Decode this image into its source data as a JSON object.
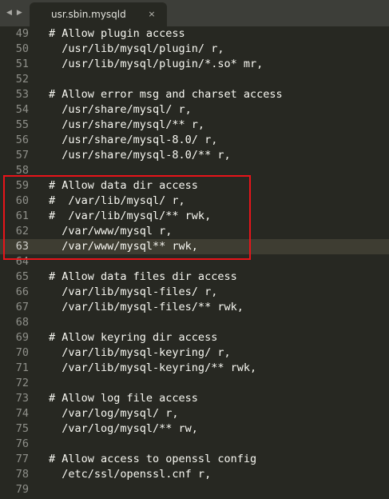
{
  "tab": {
    "title": "usr.sbin.mysqld",
    "close_glyph": "×",
    "back_glyph": "◀",
    "forward_glyph": "▶"
  },
  "colors": {
    "editor_background": "#272822",
    "tabbar_background": "#3d3e39",
    "highlight_border": "#e8141a"
  },
  "editor": {
    "current_line": 63,
    "lines": [
      {
        "num": "49",
        "text": "# Allow plugin access"
      },
      {
        "num": "50",
        "text": "  /usr/lib/mysql/plugin/ r,"
      },
      {
        "num": "51",
        "text": "  /usr/lib/mysql/plugin/*.so* mr,"
      },
      {
        "num": "52",
        "text": ""
      },
      {
        "num": "53",
        "text": "# Allow error msg and charset access"
      },
      {
        "num": "54",
        "text": "  /usr/share/mysql/ r,"
      },
      {
        "num": "55",
        "text": "  /usr/share/mysql/** r,"
      },
      {
        "num": "56",
        "text": "  /usr/share/mysql-8.0/ r,"
      },
      {
        "num": "57",
        "text": "  /usr/share/mysql-8.0/** r,"
      },
      {
        "num": "58",
        "text": ""
      },
      {
        "num": "59",
        "text": "# Allow data dir access"
      },
      {
        "num": "60",
        "text": "#  /var/lib/mysql/ r,"
      },
      {
        "num": "61",
        "text": "#  /var/lib/mysql/** rwk,"
      },
      {
        "num": "62",
        "text": "  /var/www/mysql r,"
      },
      {
        "num": "63",
        "text": "  /var/www/mysql** rwk,"
      },
      {
        "num": "64",
        "text": ""
      },
      {
        "num": "65",
        "text": "# Allow data files dir access"
      },
      {
        "num": "66",
        "text": "  /var/lib/mysql-files/ r,"
      },
      {
        "num": "67",
        "text": "  /var/lib/mysql-files/** rwk,"
      },
      {
        "num": "68",
        "text": ""
      },
      {
        "num": "69",
        "text": "# Allow keyring dir access"
      },
      {
        "num": "70",
        "text": "  /var/lib/mysql-keyring/ r,"
      },
      {
        "num": "71",
        "text": "  /var/lib/mysql-keyring/** rwk,"
      },
      {
        "num": "72",
        "text": ""
      },
      {
        "num": "73",
        "text": "# Allow log file access"
      },
      {
        "num": "74",
        "text": "  /var/log/mysql/ r,"
      },
      {
        "num": "75",
        "text": "  /var/log/mysql/** rw,"
      },
      {
        "num": "76",
        "text": ""
      },
      {
        "num": "77",
        "text": "# Allow access to openssl config"
      },
      {
        "num": "78",
        "text": "  /etc/ssl/openssl.cnf r,"
      },
      {
        "num": "79",
        "text": ""
      }
    ]
  }
}
